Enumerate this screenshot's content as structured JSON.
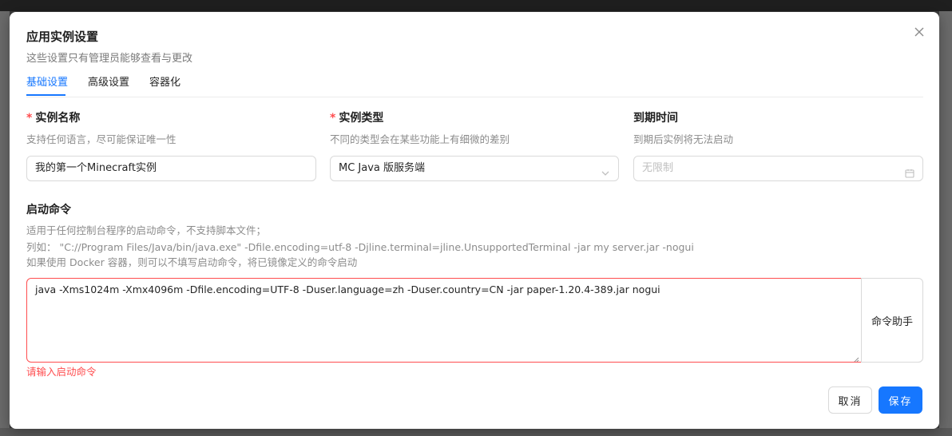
{
  "dialog": {
    "title": "应用实例设置",
    "subtitle": "这些设置只有管理员能够查看与更改",
    "close_icon": "close-icon"
  },
  "tabs": [
    {
      "label": "基础设置",
      "active": true
    },
    {
      "label": "高级设置",
      "active": false
    },
    {
      "label": "容器化",
      "active": false
    }
  ],
  "fields": {
    "name": {
      "required": "*",
      "label": "实例名称",
      "hint": "支持任何语言，尽可能保证唯一性",
      "value": "我的第一个Minecraft实例"
    },
    "type": {
      "required": "*",
      "label": "实例类型",
      "hint": "不同的类型会在某些功能上有细微的差别",
      "value": "MC Java 版服务端",
      "suffix_icon": "chevron-down-icon"
    },
    "expire": {
      "label": "到期时间",
      "hint": "到期后实例将无法启动",
      "placeholder": "无限制",
      "suffix_icon": "calendar-icon"
    }
  },
  "command": {
    "label": "启动命令",
    "desc_1": "适用于任何控制台程序的启动命令，不支持脚本文件；",
    "desc_2": "列如：  \"C://Program Files/Java/bin/java.exe\" -Dfile.encoding=utf-8 -Djline.terminal=jline.UnsupportedTerminal -jar my server.jar -nogui",
    "desc_3": "如果使用 Docker 容器，则可以不填写启动命令，将已镜像定义的命令启动",
    "value": "java -Xms1024m -Xmx4096m -Dfile.encoding=UTF-8 -Duser.language=zh -Duser.country=CN -jar paper-1.20.4-389.jar nogui",
    "helper_label": "命令助手",
    "error": "请输入启动命令"
  },
  "footer": {
    "cancel_label": "取消",
    "save_label": "保存"
  },
  "colors": {
    "primary": "#1677ff",
    "error": "#ff4d4f"
  }
}
